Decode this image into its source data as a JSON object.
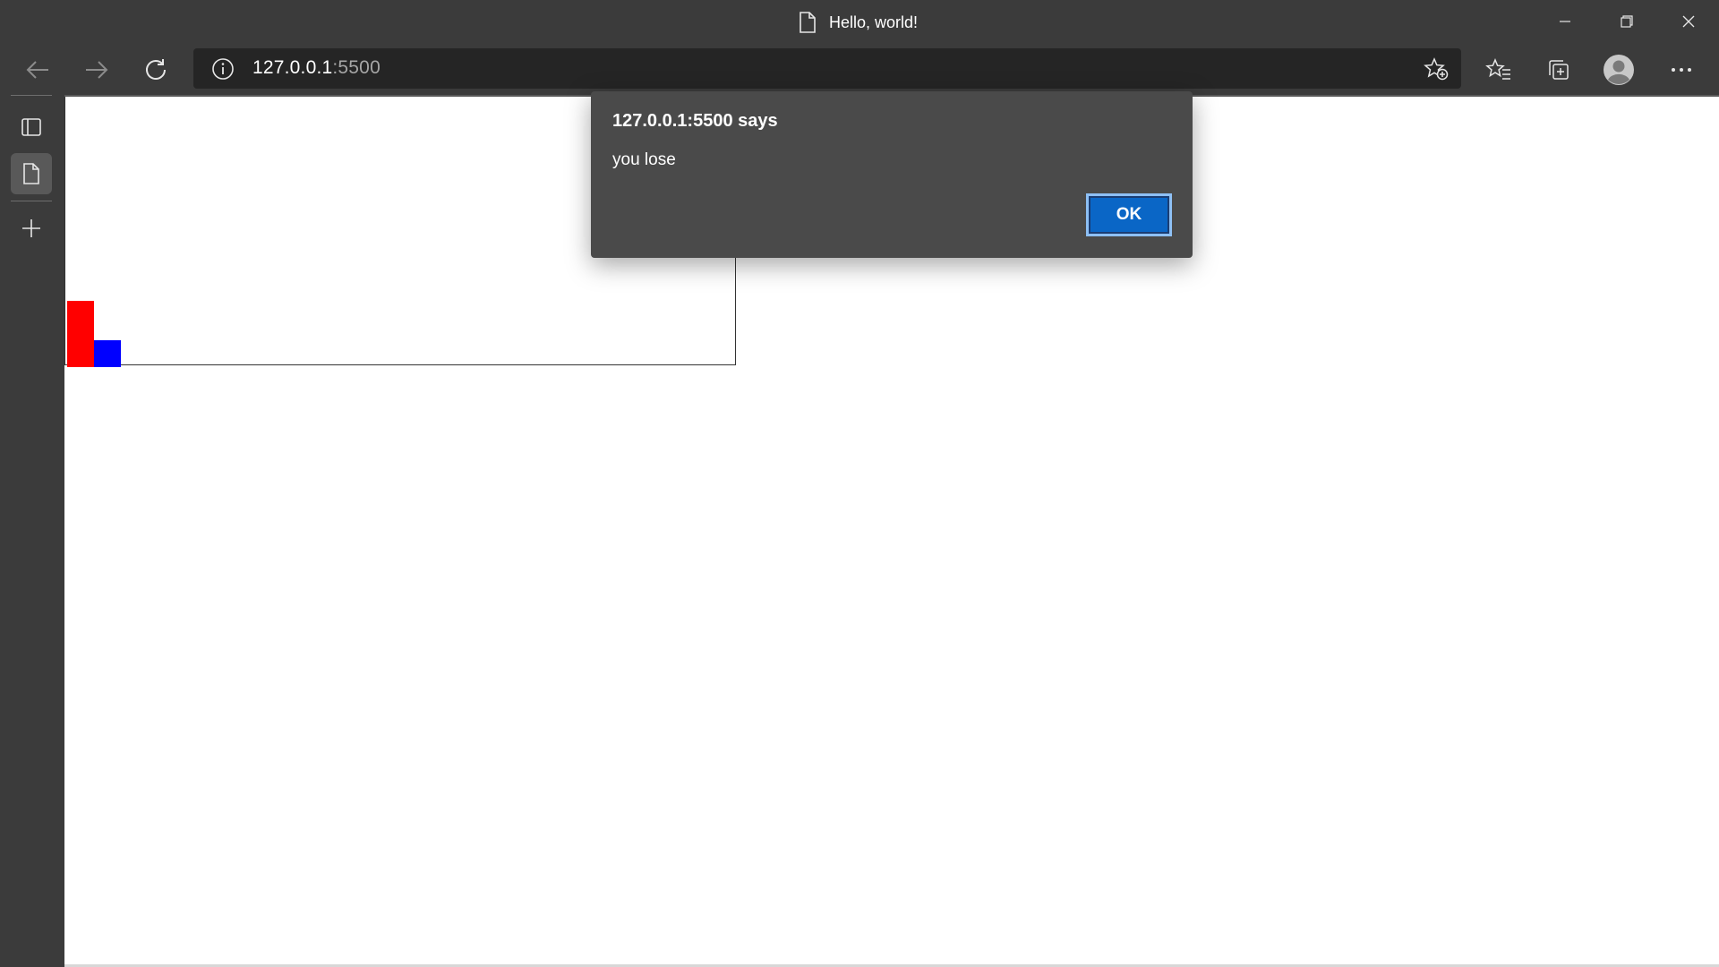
{
  "window": {
    "tab_title": "Hello, world!"
  },
  "toolbar": {
    "address_host": "127.0.0.1",
    "address_port": ":5500"
  },
  "alert": {
    "title": "127.0.0.1:5500 says",
    "message": "you lose",
    "ok_label": "OK"
  },
  "game": {
    "player_color": "#ff0000",
    "enemy_color": "#0000ff"
  },
  "colors": {
    "chrome_bg": "#3b3b3b",
    "address_bg": "#252525",
    "dialog_bg": "#4a4a4a",
    "accent": "#0a66c6"
  }
}
